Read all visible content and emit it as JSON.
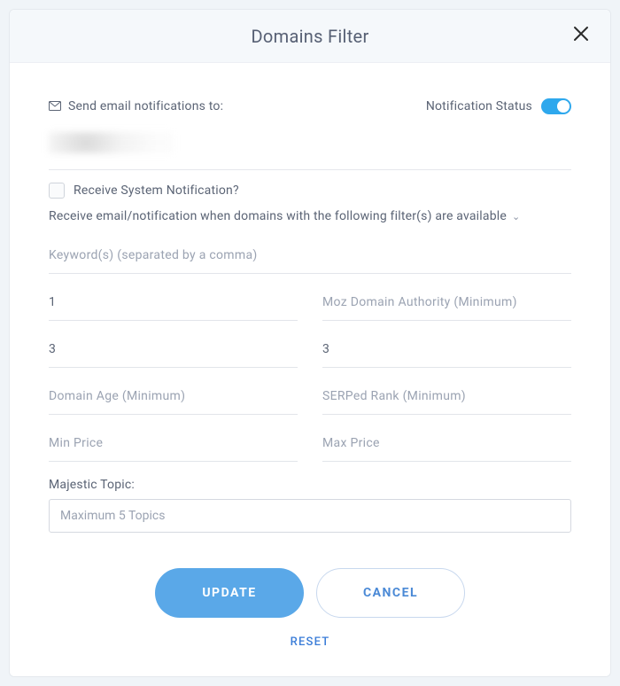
{
  "header": {
    "title": "Domains Filter"
  },
  "notifications": {
    "email_label": "Send email notifications to:",
    "status_label": "Notification Status",
    "toggle_on": true
  },
  "system_notif": {
    "checkbox_label": "Receive System Notification?",
    "description": "Receive email/notification when domains with the following filter(s) are available"
  },
  "fields": {
    "keywords_placeholder": "Keyword(s) (separated by a comma)",
    "field_a_value": "1",
    "moz_da_placeholder": "Moz Domain Authority (Minimum)",
    "field_b_value": "3",
    "field_c_value": "3",
    "domain_age_placeholder": "Domain Age (Minimum)",
    "serped_rank_placeholder": "SERPed Rank (Minimum)",
    "min_price_placeholder": "Min Price",
    "max_price_placeholder": "Max Price",
    "majestic_topic_label": "Majestic Topic:",
    "majestic_topic_placeholder": "Maximum 5 Topics"
  },
  "buttons": {
    "update": "UPDATE",
    "cancel": "CANCEL",
    "reset": "RESET"
  }
}
